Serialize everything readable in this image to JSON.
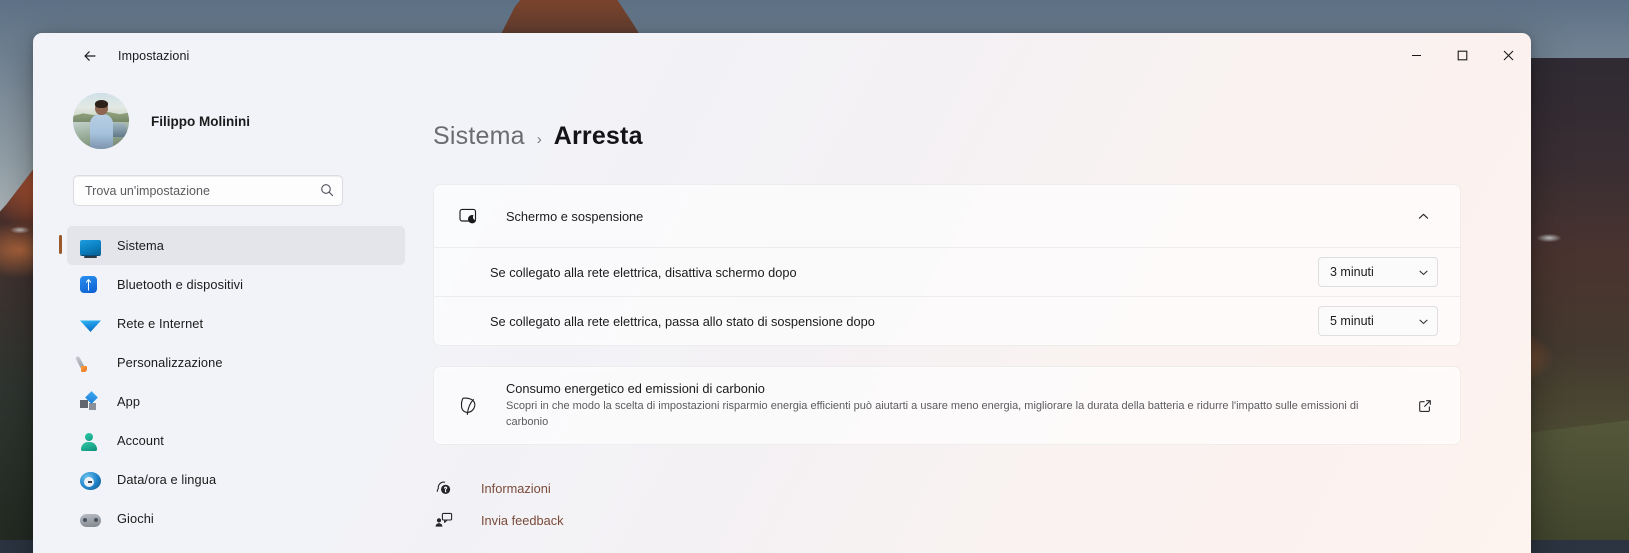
{
  "desktop": {
    "wallpaper_description": "mountain-peak-sunset"
  },
  "window": {
    "app_title": "Impostazioni",
    "back_icon": "arrow-left-icon",
    "controls": {
      "minimize_icon": "minimize-icon",
      "maximize_icon": "maximize-icon",
      "close_icon": "close-icon"
    }
  },
  "sidebar": {
    "profile": {
      "name": "Filippo Molinini",
      "avatar_icon": "user-avatar-photo"
    },
    "search": {
      "placeholder": "Trova un'impostazione",
      "value": "",
      "icon": "search-icon"
    },
    "items": [
      {
        "label": "Sistema",
        "icon": "monitor-icon",
        "selected": true
      },
      {
        "label": "Bluetooth e dispositivi",
        "icon": "bluetooth-icon",
        "selected": false
      },
      {
        "label": "Rete e Internet",
        "icon": "wifi-icon",
        "selected": false
      },
      {
        "label": "Personalizzazione",
        "icon": "paintbrush-icon",
        "selected": false
      },
      {
        "label": "App",
        "icon": "apps-icon",
        "selected": false
      },
      {
        "label": "Account",
        "icon": "account-icon",
        "selected": false
      },
      {
        "label": "Data/ora e lingua",
        "icon": "clock-icon",
        "selected": false
      },
      {
        "label": "Giochi",
        "icon": "gamepad-icon",
        "selected": false
      }
    ],
    "accent_color": "#9a5a2b"
  },
  "main": {
    "breadcrumb": {
      "parent": "Sistema",
      "separator": "›",
      "current": "Arresta"
    },
    "sleep_section": {
      "title": "Schermo e sospensione",
      "icon": "screen-sleep-icon",
      "expanded": true,
      "collapse_icon": "chevron-up-icon",
      "rows": [
        {
          "label": "Se collegato alla rete elettrica, disattiva schermo dopo",
          "value": "3 minuti",
          "chevron_icon": "chevron-down-icon"
        },
        {
          "label": "Se collegato alla rete elettrica, passa allo stato di sospensione dopo",
          "value": "5 minuti",
          "chevron_icon": "chevron-down-icon"
        }
      ]
    },
    "carbon_card": {
      "icon": "leaf-icon",
      "title": "Consumo energetico ed emissioni di carbonio",
      "description": "Scopri in che modo la scelta di impostazioni risparmio energia efficienti può aiutarti a usare meno energia, migliorare la durata della batteria e ridurre l'impatto sulle emissioni di carbonio",
      "link_icon": "open-external-icon"
    },
    "footer_links": [
      {
        "label": "Informazioni",
        "icon": "help-info-icon"
      },
      {
        "label": "Invia feedback",
        "icon": "feedback-icon"
      }
    ],
    "link_color": "#7a4b3a"
  }
}
